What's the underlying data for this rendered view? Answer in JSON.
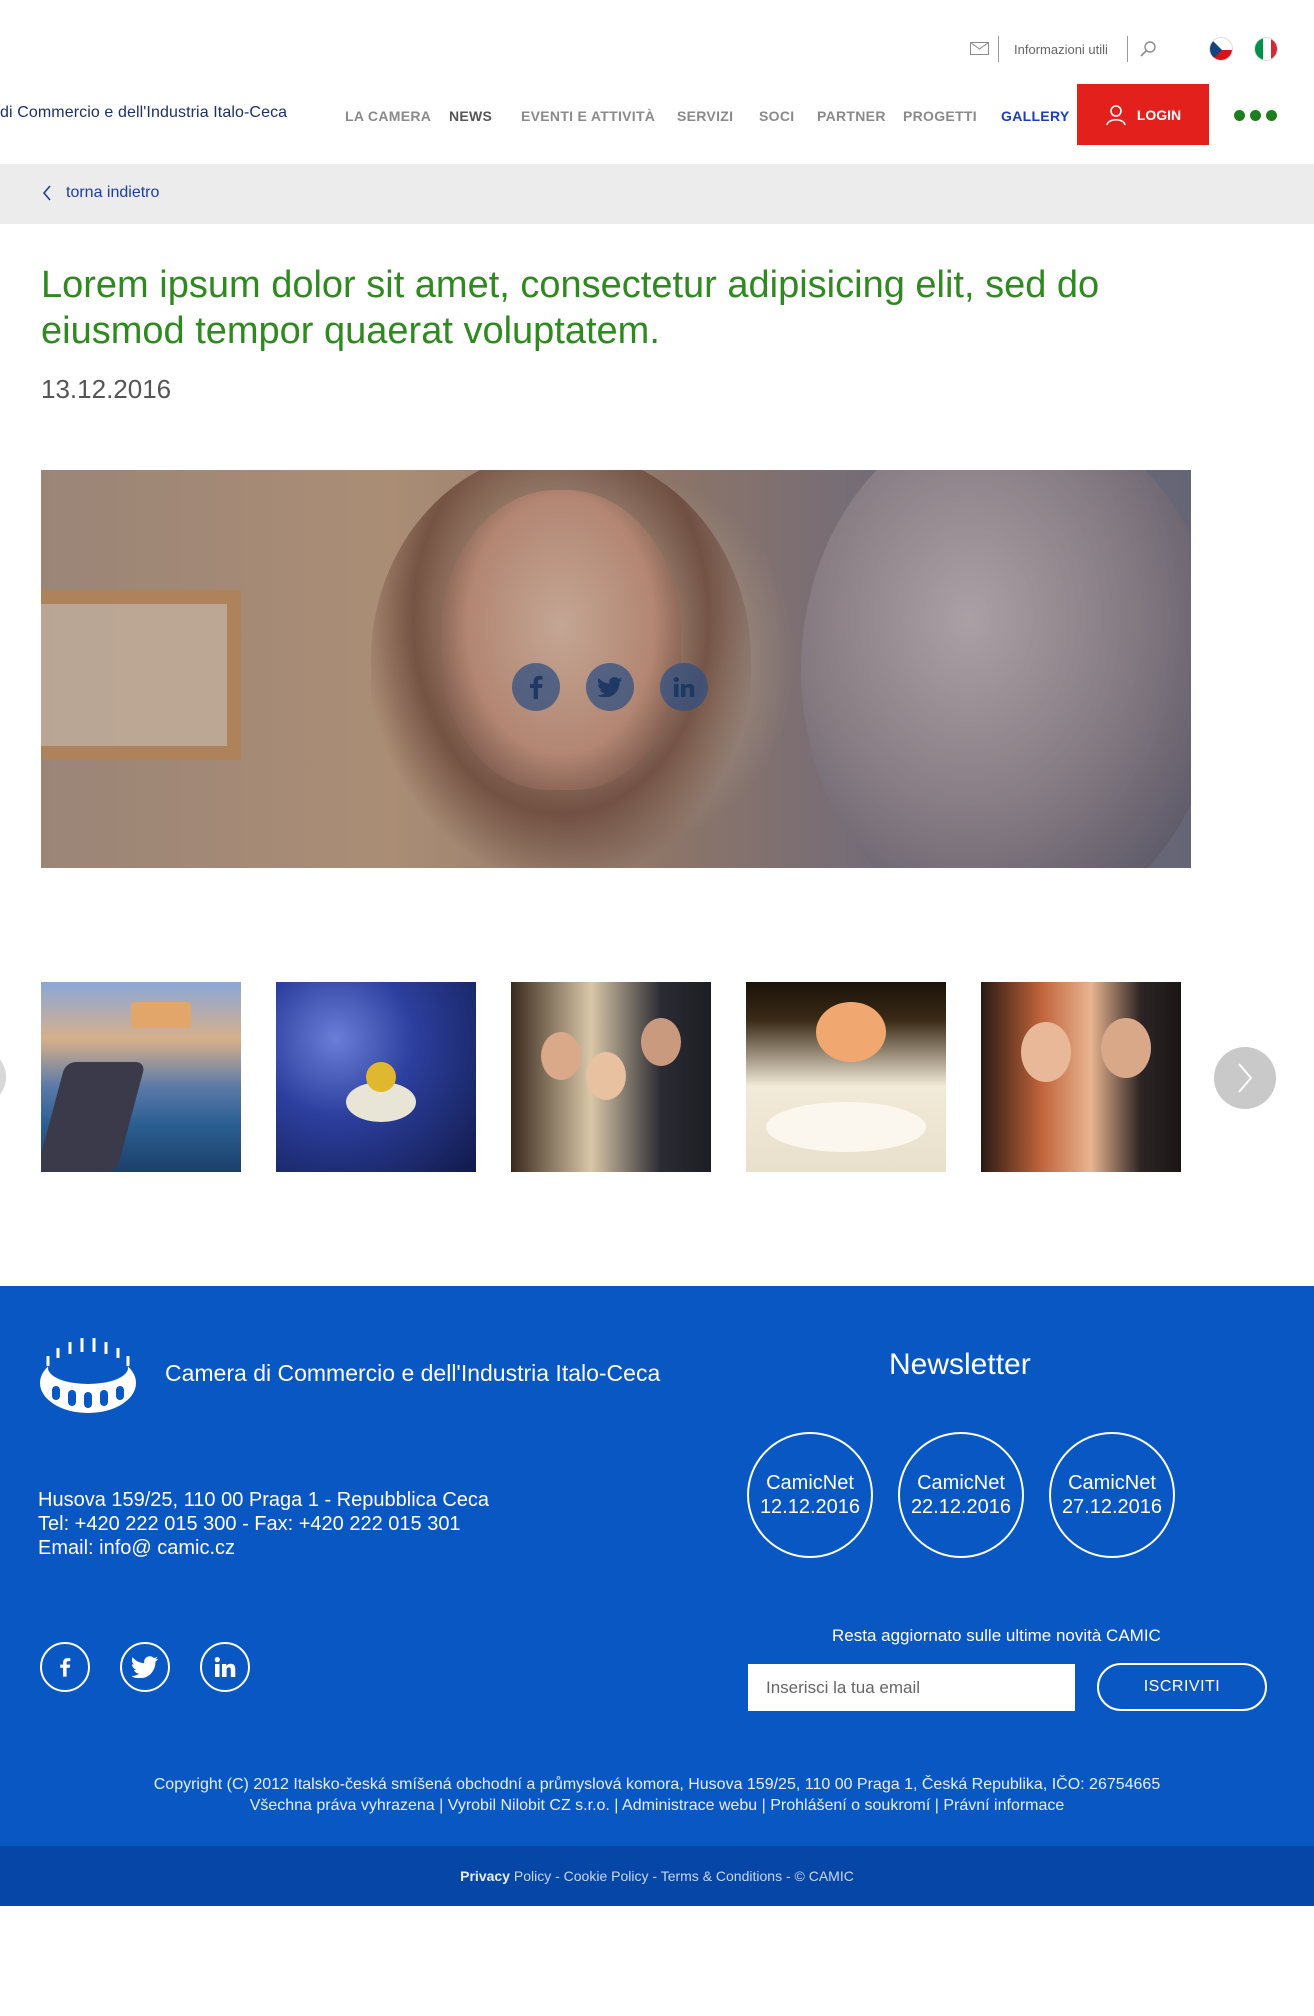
{
  "topbar": {
    "info_label": "Informazioni utili",
    "icons": [
      "mail-icon",
      "search-icon",
      "flag-cz-icon",
      "flag-it-icon"
    ]
  },
  "header": {
    "brand": "di Commercio e dell'Industria Italo-Ceca",
    "nav": [
      "LA CAMERA",
      "NEWS",
      "EVENTI E ATTIVITÀ",
      "SERVIZI",
      "SOCI",
      "PARTNER",
      "PROGETTI",
      "GALLERY"
    ],
    "login_label": "LOGIN"
  },
  "back": {
    "label": "torna indietro"
  },
  "article": {
    "title": "Lorem ipsum dolor sit amet, consectetur adipisicing elit, sed do eiusmod tempor quaerat voluptatem.",
    "date": "13.12.2016",
    "share_icons": [
      "facebook-icon",
      "twitter-icon",
      "linkedin-icon"
    ]
  },
  "footer": {
    "org_name": "Camera di Commercio e dell'Industria Italo-Ceca",
    "address_line1": "Husova 159/25, 110 00 Praga 1 - Repubblica Ceca",
    "address_line2": "Tel: +420 222 015 300 - Fax: +420 222 015 301",
    "address_line3": "Email: info@ camic.cz",
    "newsletter_title": "Newsletter",
    "newsletters": [
      {
        "name": "CamicNet",
        "date": "12.12.2016"
      },
      {
        "name": "CamicNet",
        "date": "22.12.2016"
      },
      {
        "name": "CamicNet",
        "date": "27.12.2016"
      }
    ],
    "subscribe_text": "Resta aggiornato sulle ultime novità CAMIC",
    "email_placeholder": "Inserisci la tua email",
    "subscribe_button": "ISCRIVITI",
    "copyright_line1": "Copyright (C) 2012 Italsko-česká smíšená obchodní a průmyslová komora, Husova 159/25, 110 00 Praga 1, Česká Republika, IČO: 26754665",
    "copyright_line2": "Všechna práva vyhrazena | Vyrobil Nilobit CZ s.r.o. | Administrace webu | Prohlášení o soukromí | Právní informace"
  },
  "bottom": {
    "privacy_bold": "Privacy",
    "privacy_rest": " Policy",
    "sep1": " - ",
    "cookie": "Cookie Policy",
    "sep2": " - ",
    "terms": "Terms & Conditions",
    "sep3": " - ",
    "camic": "© CAMIC"
  },
  "colors": {
    "title_green": "#2e8a1e",
    "login_red": "#e3201b",
    "footer_blue": "#0857c3",
    "bottom_blue": "#0646a6",
    "gallery_blue": "#1a3ec0"
  }
}
